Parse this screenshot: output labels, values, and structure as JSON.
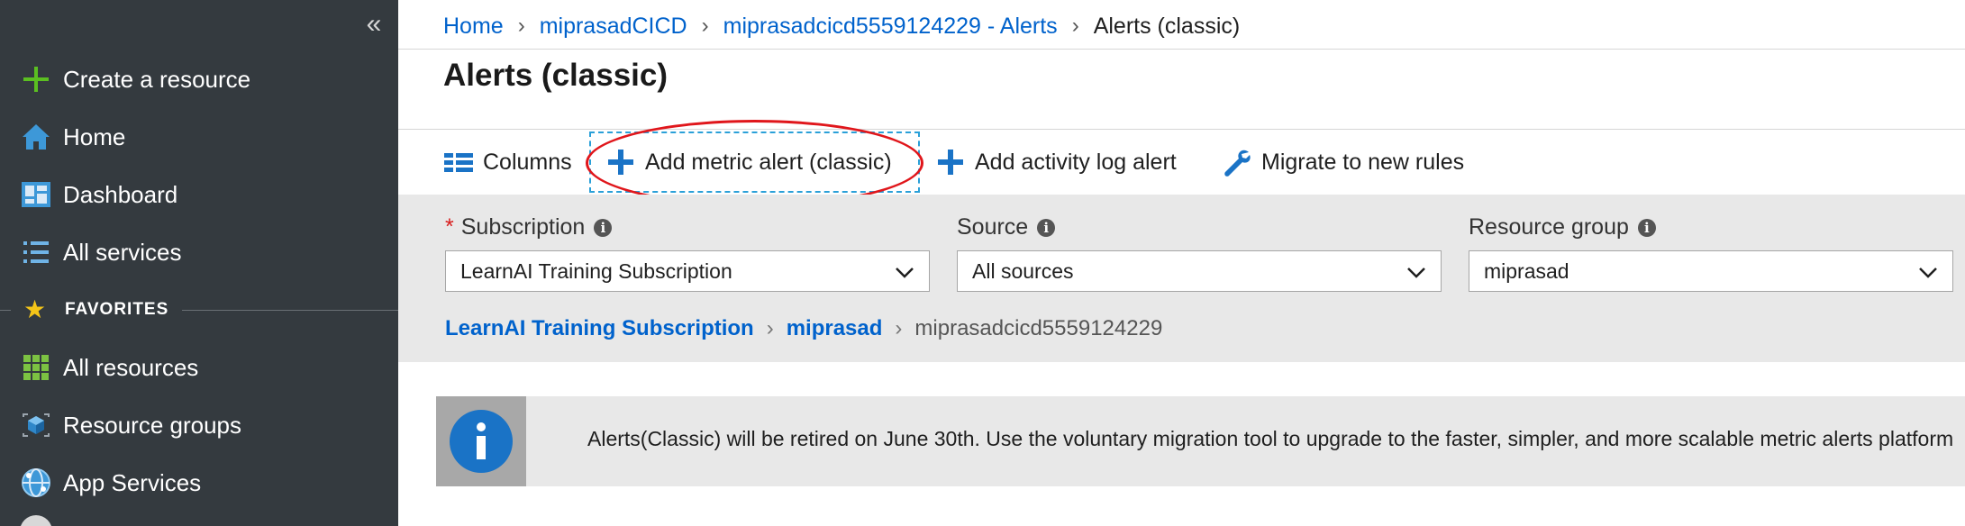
{
  "sidebar": {
    "collapse_label": "«",
    "items": [
      {
        "label": "Create a resource",
        "icon": "plus-icon"
      },
      {
        "label": "Home",
        "icon": "home-icon"
      },
      {
        "label": "Dashboard",
        "icon": "dashboard-icon"
      },
      {
        "label": "All services",
        "icon": "list-icon"
      }
    ],
    "favorites_label": "FAVORITES",
    "favorites": [
      {
        "label": "All resources",
        "icon": "grid-icon"
      },
      {
        "label": "Resource groups",
        "icon": "cube-icon"
      },
      {
        "label": "App Services",
        "icon": "globe-icon"
      }
    ]
  },
  "breadcrumb": [
    {
      "label": "Home"
    },
    {
      "label": "miprasadCICD"
    },
    {
      "label": "miprasadcicd5559124229 - Alerts"
    },
    {
      "label": "Alerts (classic)"
    }
  ],
  "page_title": "Alerts (classic)",
  "toolbar": {
    "columns_label": "Columns",
    "add_metric_label": "Add metric alert (classic)",
    "add_activity_label": "Add activity log alert",
    "migrate_label": "Migrate to new rules"
  },
  "filters": {
    "subscription_label": "Subscription",
    "required_mark": "*",
    "subscription_value": "LearnAI Training Subscription",
    "source_label": "Source",
    "source_value": "All sources",
    "resource_group_label": "Resource group",
    "resource_group_value": "miprasad"
  },
  "scope_path": {
    "subscription": "LearnAI Training Subscription",
    "resource_group": "miprasad",
    "resource": "miprasadcicd5559124229"
  },
  "banner": {
    "message": "Alerts(Classic) will be retired on June 30th. Use the voluntary migration tool to upgrade to the faster, simpler, and more scalable metric alerts platform"
  },
  "colors": {
    "sidebar_bg": "#343a3f",
    "link": "#0062cc",
    "accent_blue": "#1a73c6",
    "annotation_red": "#e0161b",
    "plus_green": "#5bbf21"
  }
}
